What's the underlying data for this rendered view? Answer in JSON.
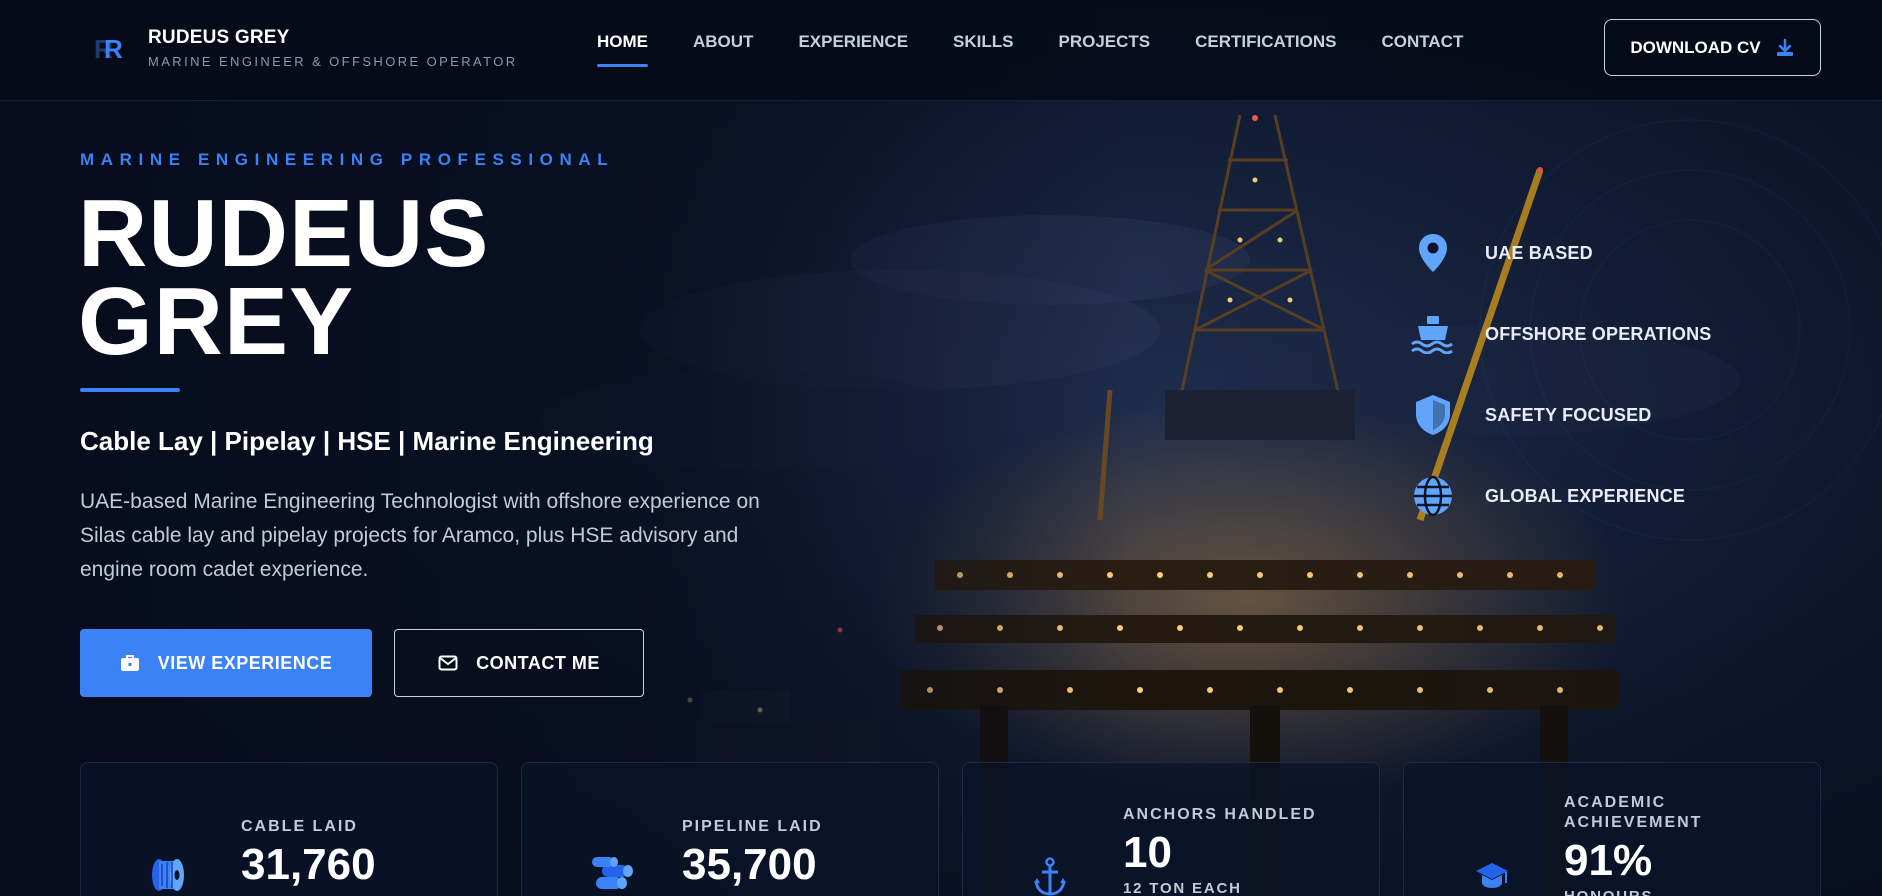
{
  "brand": {
    "name": "RUDEUS GREY",
    "tagline": "MARINE ENGINEER & OFFSHORE OPERATOR",
    "logo_icon": "rr-monogram-icon",
    "accent_color": "#3b82f6"
  },
  "nav": {
    "items": [
      {
        "label": "HOME",
        "active": true
      },
      {
        "label": "ABOUT",
        "active": false
      },
      {
        "label": "EXPERIENCE",
        "active": false
      },
      {
        "label": "SKILLS",
        "active": false
      },
      {
        "label": "PROJECTS",
        "active": false
      },
      {
        "label": "CERTIFICATIONS",
        "active": false
      },
      {
        "label": "CONTACT",
        "active": false
      }
    ],
    "download_label": "DOWNLOAD CV",
    "download_icon": "download-icon"
  },
  "hero": {
    "eyebrow": "MARINE ENGINEERING PROFESSIONAL",
    "name_line1": "RUDEUS",
    "name_line2": "GREY",
    "subtitle": "Cable Lay | Pipelay | HSE | Marine Engineering",
    "description": "UAE-based Marine Engineering Technologist with offshore experience on Silas cable lay and pipelay projects for Aramco, plus HSE advisory and engine room cadet experience.",
    "primary_button": {
      "label": "VIEW EXPERIENCE",
      "icon": "briefcase-icon"
    },
    "secondary_button": {
      "label": "CONTACT ME",
      "icon": "envelope-icon"
    }
  },
  "features": [
    {
      "label": "UAE BASED",
      "icon": "map-pin-icon"
    },
    {
      "label": "OFFSHORE OPERATIONS",
      "icon": "ship-icon"
    },
    {
      "label": "SAFETY FOCUSED",
      "icon": "shield-icon"
    },
    {
      "label": "GLOBAL EXPERIENCE",
      "icon": "globe-icon"
    }
  ],
  "stats": [
    {
      "label": "CABLE LAID",
      "value": "31,760",
      "sub": "",
      "icon": "cable-reel-icon"
    },
    {
      "label": "PIPELINE LAID",
      "value": "35,700",
      "sub": "",
      "icon": "pipes-icon"
    },
    {
      "label": "ANCHORS HANDLED",
      "value": "10",
      "sub": "12 TON EACH",
      "icon": "anchor-icon"
    },
    {
      "label": "ACADEMIC ACHIEVEMENT",
      "value": "91%",
      "sub": "HONOURS",
      "icon": "graduation-cap-icon"
    }
  ]
}
